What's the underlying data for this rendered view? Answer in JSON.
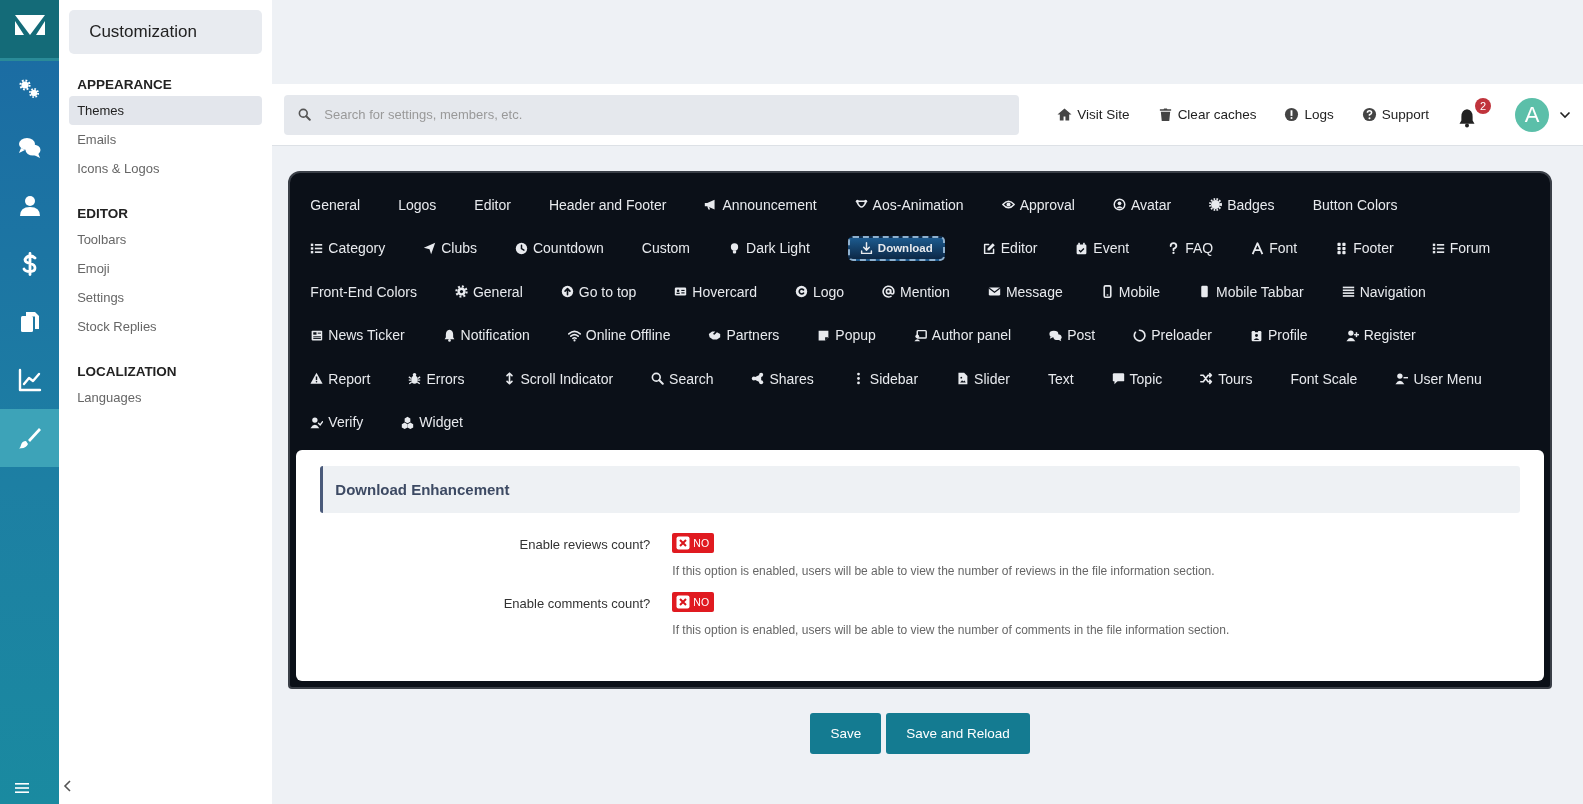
{
  "rail": [
    {
      "selected": false
    },
    {
      "selected": false
    },
    {
      "selected": false
    },
    {
      "selected": false
    },
    {
      "selected": false
    },
    {
      "selected": false
    },
    {
      "selected": true
    }
  ],
  "sidebar": {
    "title": "Customization",
    "sections": [
      {
        "heading": "APPEARANCE",
        "items": [
          {
            "label": "Themes",
            "selected": true
          },
          {
            "label": "Emails",
            "selected": false
          },
          {
            "label": "Icons & Logos",
            "selected": false
          }
        ]
      },
      {
        "heading": "EDITOR",
        "items": [
          {
            "label": "Toolbars",
            "selected": false
          },
          {
            "label": "Emoji",
            "selected": false
          },
          {
            "label": "Settings",
            "selected": false
          },
          {
            "label": "Stock Replies",
            "selected": false
          }
        ]
      },
      {
        "heading": "LOCALIZATION",
        "items": [
          {
            "label": "Languages",
            "selected": false
          }
        ]
      }
    ]
  },
  "search": {
    "placeholder": "Search for settings, members, etc."
  },
  "header_links": [
    "Visit Site",
    "Clear caches",
    "Logs",
    "Support"
  ],
  "notifications": {
    "count": "2"
  },
  "avatar": {
    "letter": "A"
  },
  "tab_rows": [
    [
      {
        "label": "General",
        "selected": false
      },
      {
        "label": "Logos",
        "selected": false
      },
      {
        "label": "Editor",
        "selected": false
      },
      {
        "label": "Header and Footer",
        "selected": false
      },
      {
        "label": "Announcement",
        "selected": false
      },
      {
        "label": "Aos-Animation",
        "selected": false
      },
      {
        "label": "Approval",
        "selected": false
      },
      {
        "label": "Avatar",
        "selected": false
      },
      {
        "label": "Badges",
        "selected": false
      },
      {
        "label": "Button Colors",
        "selected": false
      }
    ],
    [
      {
        "label": "Category",
        "selected": false
      },
      {
        "label": "Clubs",
        "selected": false
      },
      {
        "label": "Countdown",
        "selected": false
      },
      {
        "label": "Custom",
        "selected": false
      },
      {
        "label": "Dark Light",
        "selected": false
      },
      {
        "label": "Download",
        "selected": true
      },
      {
        "label": "Editor",
        "selected": false
      },
      {
        "label": "Event",
        "selected": false
      },
      {
        "label": "FAQ",
        "selected": false
      },
      {
        "label": "Font",
        "selected": false
      },
      {
        "label": "Footer",
        "selected": false
      },
      {
        "label": "Forum",
        "selected": false
      }
    ],
    [
      {
        "label": "Front-End Colors",
        "selected": false
      },
      {
        "label": "General",
        "selected": false
      },
      {
        "label": "Go to top",
        "selected": false
      },
      {
        "label": "Hovercard",
        "selected": false
      },
      {
        "label": "Logo",
        "selected": false
      },
      {
        "label": "Mention",
        "selected": false
      },
      {
        "label": "Message",
        "selected": false
      },
      {
        "label": "Mobile",
        "selected": false
      },
      {
        "label": "Mobile Tabbar",
        "selected": false
      },
      {
        "label": "Navigation",
        "selected": false
      }
    ],
    [
      {
        "label": "News Ticker",
        "selected": false
      },
      {
        "label": "Notification",
        "selected": false
      },
      {
        "label": "Online Offline",
        "selected": false
      },
      {
        "label": "Partners",
        "selected": false
      },
      {
        "label": "Popup",
        "selected": false
      },
      {
        "label": "Author panel",
        "selected": false
      },
      {
        "label": "Post",
        "selected": false
      },
      {
        "label": "Preloader",
        "selected": false
      },
      {
        "label": "Profile",
        "selected": false
      },
      {
        "label": "Register",
        "selected": false
      }
    ],
    [
      {
        "label": "Report",
        "selected": false
      },
      {
        "label": "Errors",
        "selected": false
      },
      {
        "label": "Scroll Indicator",
        "selected": false
      },
      {
        "label": "Search",
        "selected": false
      },
      {
        "label": "Shares",
        "selected": false
      },
      {
        "label": "Sidebar",
        "selected": false
      },
      {
        "label": "Slider",
        "selected": false
      },
      {
        "label": "Text",
        "selected": false
      },
      {
        "label": "Topic",
        "selected": false
      },
      {
        "label": "Tours",
        "selected": false
      },
      {
        "label": "Font Scale",
        "selected": false
      },
      {
        "label": "User Menu",
        "selected": false
      }
    ],
    [
      {
        "label": "Verify",
        "selected": false
      },
      {
        "label": "Widget",
        "selected": false
      }
    ]
  ],
  "section": {
    "title": "Download Enhancement",
    "options": [
      {
        "label": "Enable reviews count?",
        "on": false,
        "state_label": "NO",
        "hint": "If this option is enabled, users will be able to view the number of reviews in the file information section."
      },
      {
        "label": "Enable comments count?",
        "on": false,
        "state_label": "NO",
        "hint": "If this option is enabled, users will be able to view the number of comments in the file information section."
      }
    ]
  },
  "buttons": [
    "Save",
    "Save and Reload"
  ]
}
